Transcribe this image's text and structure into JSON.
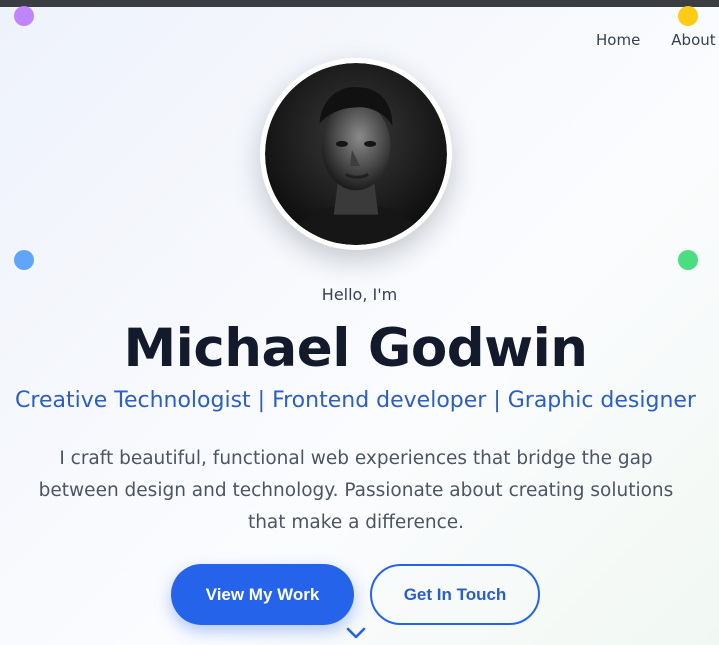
{
  "nav": {
    "links": [
      "Home",
      "About"
    ]
  },
  "decor": {
    "dots": [
      {
        "name": "purple-dot",
        "color": "#c084fc"
      },
      {
        "name": "yellow-dot",
        "color": "#facc15"
      },
      {
        "name": "blue-dot",
        "color": "#60a5fa"
      },
      {
        "name": "green-dot",
        "color": "#4ade80"
      }
    ]
  },
  "hero": {
    "greeting": "Hello, I'm",
    "name": "Michael Godwin",
    "roles": "Creative Technologist | Frontend developer | Graphic designer",
    "bio": "I craft beautiful, functional web experiences that bridge the gap between design and technology. Passionate about creating solutions that make a difference.",
    "primary_button": "View My Work",
    "secondary_button": "Get In Touch",
    "scroll_icon": "chevron-down-icon"
  },
  "colors": {
    "accent": "#2563eb",
    "heading": "#121a2c",
    "roles": "#2b5ec7"
  }
}
